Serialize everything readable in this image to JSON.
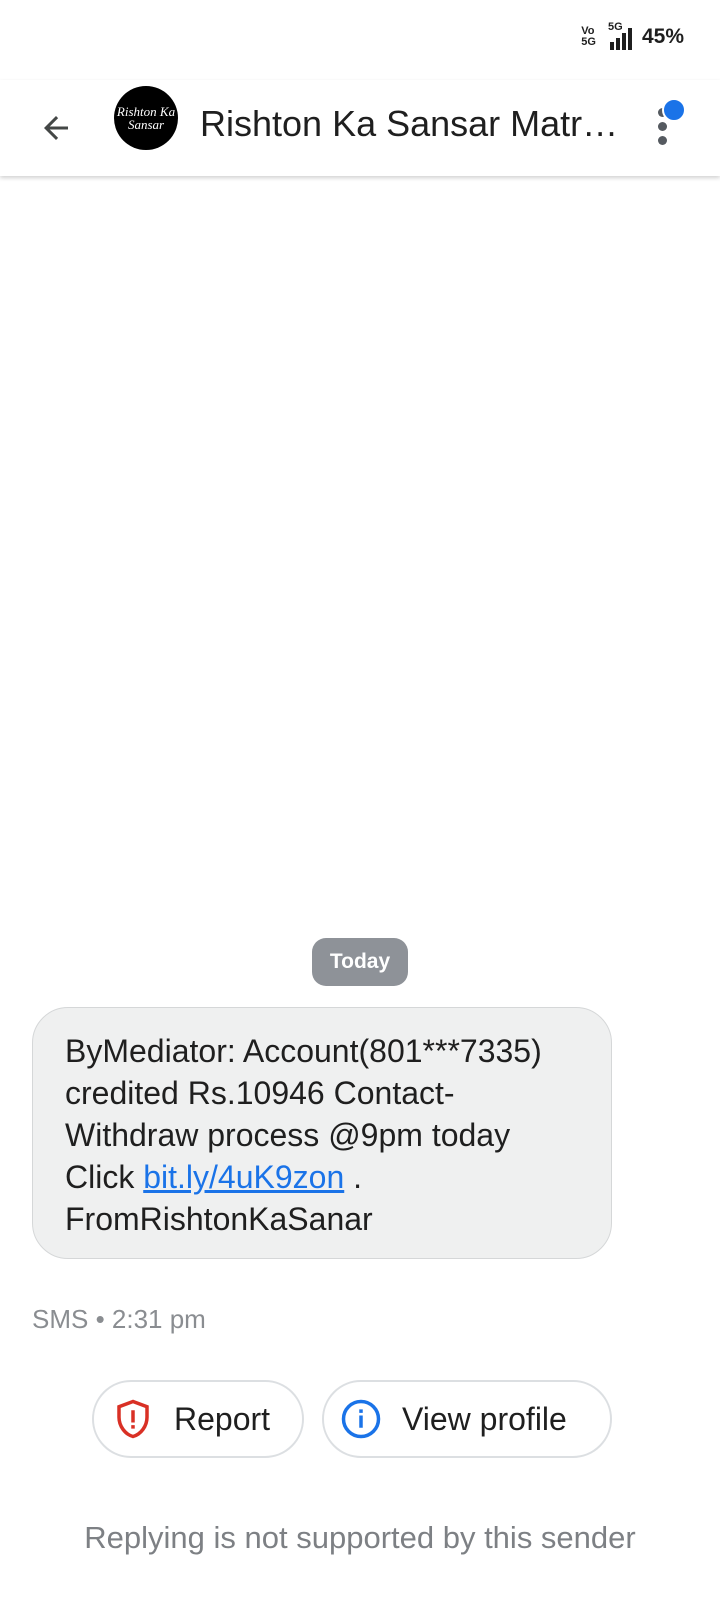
{
  "status_bar": {
    "volte_top": "Vo",
    "volte_bottom": "5G",
    "network": "5G",
    "battery": "45%"
  },
  "header": {
    "title": "Rishton Ka Sansar Matri...",
    "avatar_text": "Rishton Ka Sansar"
  },
  "conversation": {
    "date_label": "Today",
    "message": {
      "text_before_link": "ByMediator: Account(801***7335) credited Rs.10946 Contact-Withdraw process @9pm today Click ",
      "link": "bit.ly/4uK9zon",
      "text_after_link": " . FromRishtonKaSanar",
      "meta": "SMS • 2:31 pm"
    }
  },
  "actions": {
    "report_label": "Report",
    "view_profile_label": "View profile"
  },
  "footer": {
    "note": "Replying is not supported by this sender"
  },
  "colors": {
    "accent": "#1a73e8",
    "report_red": "#d93025",
    "bubble_bg": "#eff0f0",
    "date_chip_bg": "#8e9298"
  }
}
